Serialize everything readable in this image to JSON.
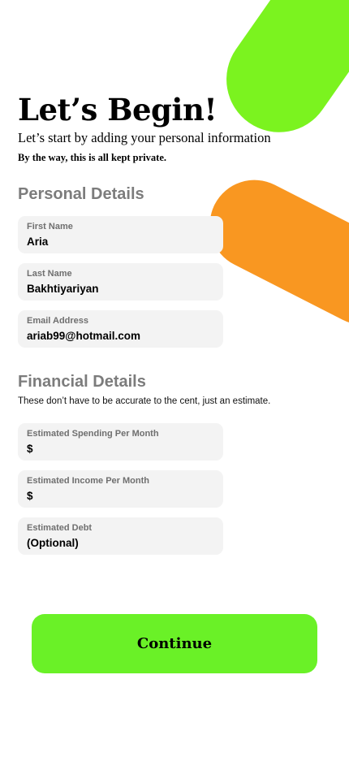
{
  "header": {
    "title": "Let’s Begin!",
    "subtitle": "Let’s start by adding your personal information",
    "private_note": "By the way, this is all kept private."
  },
  "personal_details": {
    "section_title": "Personal Details",
    "fields": [
      {
        "label": "First Name",
        "value": "Aria"
      },
      {
        "label": "Last Name",
        "value": "Bakhtiyariyan"
      },
      {
        "label": "Email Address",
        "value": "ariab99@hotmail.com"
      }
    ]
  },
  "financial_details": {
    "section_title": "Financial Details",
    "note": "These don’t have to be accurate to the cent, just an estimate.",
    "fields": [
      {
        "label": "Estimated Spending Per Month",
        "value": "$"
      },
      {
        "label": "Estimated Income Per Month",
        "value": "$"
      },
      {
        "label": "Estimated Debt",
        "value": "(Optional)"
      }
    ]
  },
  "actions": {
    "continue_label": "Continue"
  },
  "colors": {
    "green_accent": "#7bf31f",
    "orange_accent": "#f99721",
    "button_green": "#6af127",
    "field_background": "#f3f3f3"
  }
}
